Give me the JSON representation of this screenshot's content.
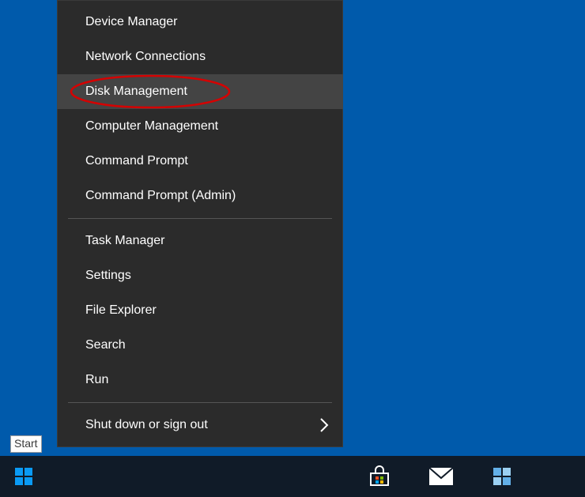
{
  "menu": {
    "groups": [
      [
        {
          "label": "Device Manager",
          "hover": false,
          "submenu": false,
          "highlight": false
        },
        {
          "label": "Network Connections",
          "hover": false,
          "submenu": false,
          "highlight": false
        },
        {
          "label": "Disk Management",
          "hover": true,
          "submenu": false,
          "highlight": true
        },
        {
          "label": "Computer Management",
          "hover": false,
          "submenu": false,
          "highlight": false
        },
        {
          "label": "Command Prompt",
          "hover": false,
          "submenu": false,
          "highlight": false
        },
        {
          "label": "Command Prompt (Admin)",
          "hover": false,
          "submenu": false,
          "highlight": false
        }
      ],
      [
        {
          "label": "Task Manager",
          "hover": false,
          "submenu": false,
          "highlight": false
        },
        {
          "label": "Settings",
          "hover": false,
          "submenu": false,
          "highlight": false
        },
        {
          "label": "File Explorer",
          "hover": false,
          "submenu": false,
          "highlight": false
        },
        {
          "label": "Search",
          "hover": false,
          "submenu": false,
          "highlight": false
        },
        {
          "label": "Run",
          "hover": false,
          "submenu": false,
          "highlight": false
        }
      ],
      [
        {
          "label": "Shut down or sign out",
          "hover": false,
          "submenu": true,
          "highlight": false
        }
      ]
    ]
  },
  "tooltip": {
    "start": "Start"
  },
  "colors": {
    "desktop": "#005aab",
    "taskbar": "#101b28",
    "menu_bg": "#2b2b2b",
    "menu_hover": "#444444",
    "highlight_ring": "#d40202"
  },
  "tray_icons": [
    "store-icon",
    "mail-icon",
    "edge-tiles-icon"
  ]
}
